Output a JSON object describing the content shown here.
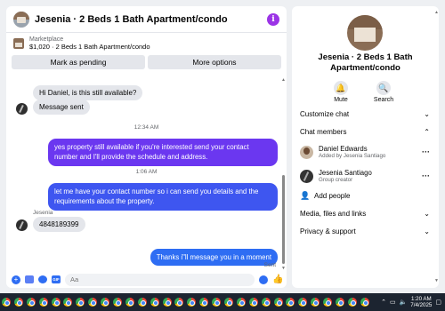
{
  "chat": {
    "title": "Jesenia · 2 Beds 1 Bath Apartment/condo",
    "marketplace_label": "Marketplace",
    "listing_line": "$1,020 · 2 Beds 1 Bath Apartment/condo",
    "mark_pending_label": "Mark as pending",
    "more_options_label": "More options",
    "composer_placeholder": "Aa"
  },
  "messages": {
    "m1": "Hi Daniel, is this still available?",
    "m2": "Message sent",
    "ts1": "12:34 AM",
    "m3": "yes property still available if you're interested send your contact number and I'll provide the schedule and address.",
    "ts2": "1:06 AM",
    "m4": "let me have your contact number so i can send you details and the requirements about the property.",
    "sender": "Jesenia",
    "m5": "4848189399",
    "m6": "Thanks i\"ll message you in a moment",
    "sent": "Sent"
  },
  "sidebar": {
    "title": "Jesenia · 2 Beds 1 Bath Apartment/condo",
    "mute_label": "Mute",
    "search_label": "Search",
    "customize_chat": "Customize chat",
    "chat_members": "Chat members",
    "members": [
      {
        "name": "Daniel Edwards",
        "sub": "Added by Jesenia Santiago"
      },
      {
        "name": "Jesenia Santiago",
        "sub": "Group creator"
      }
    ],
    "add_people": "Add people",
    "media_files_links": "Media, files and links",
    "privacy_support": "Privacy & support"
  },
  "taskbar": {
    "time": "1:20 AM",
    "date": "7/4/2025"
  },
  "colors": {
    "accent_purple": "#6b37f0",
    "accent_blue": "#3e56f0",
    "messenger_blue": "#2e6df3",
    "info_icon": "#9b34e6"
  }
}
